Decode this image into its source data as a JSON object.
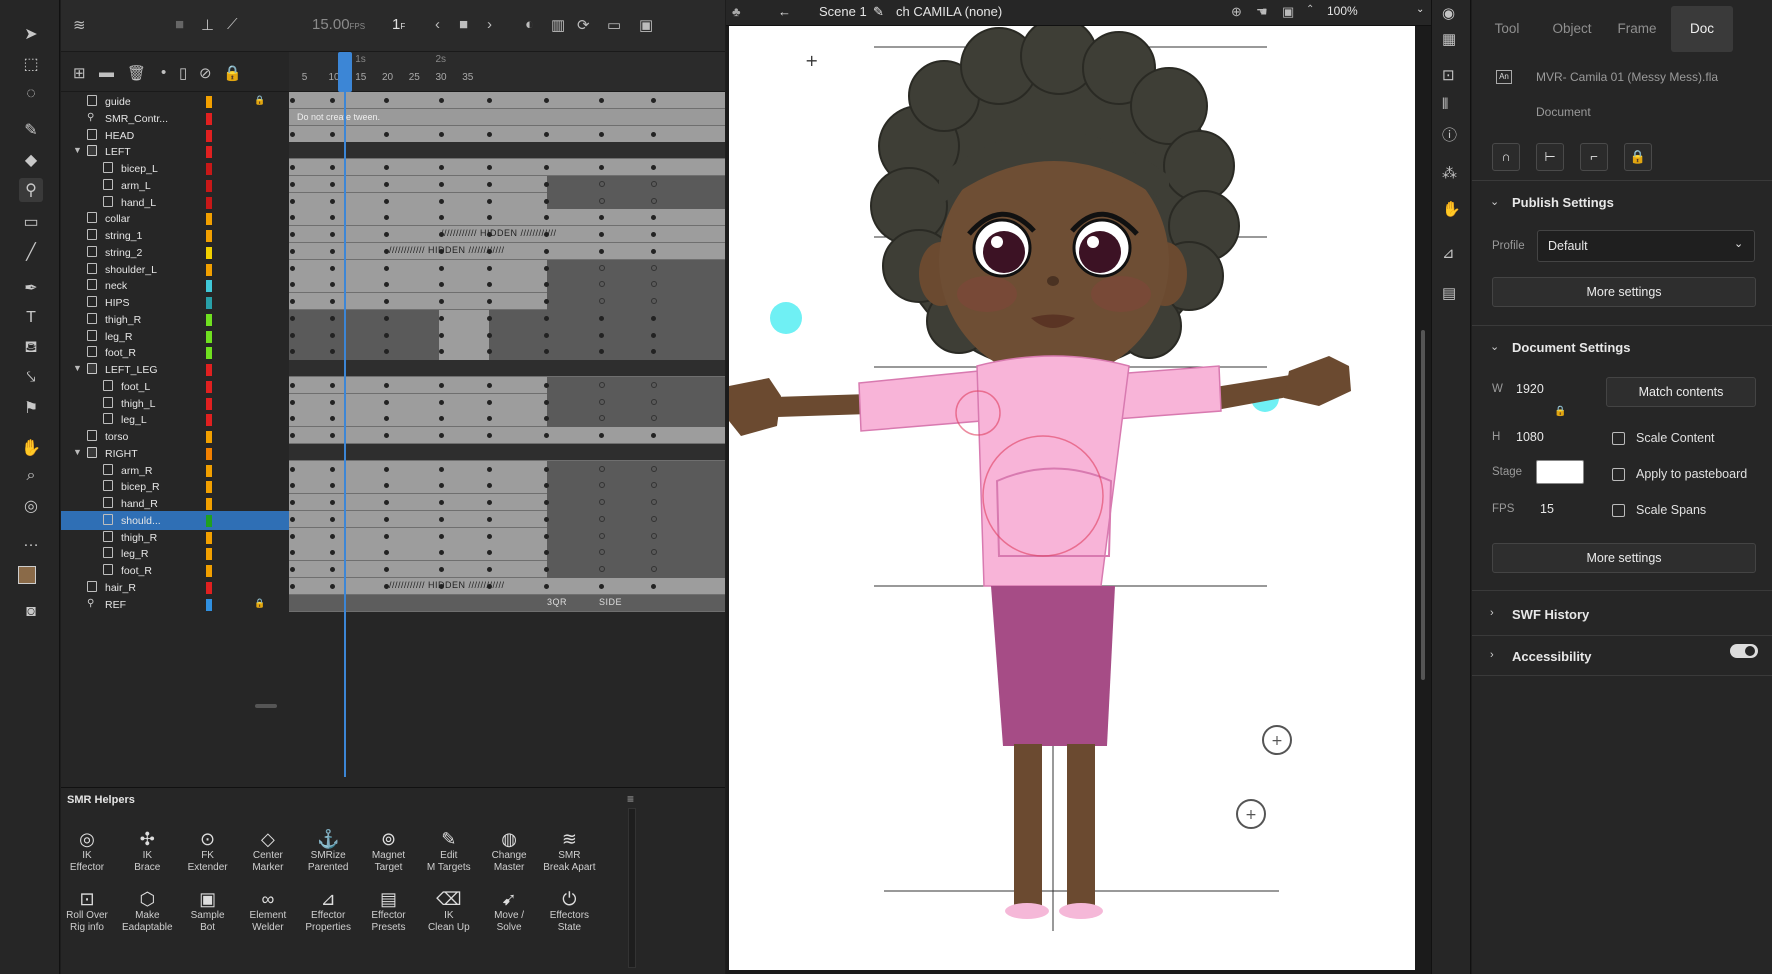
{
  "toolbar": {
    "tools": [
      "selection-icon",
      "free-transform-icon",
      "lasso-icon",
      "brush-icon",
      "eraser-icon",
      "bone-icon",
      "rectangle-icon",
      "line-icon",
      "pen-icon",
      "text-icon",
      "paint-bucket-icon",
      "eyedropper-icon",
      "pin-icon",
      "hand-icon",
      "zoom-icon",
      "camera-icon",
      "more-icon"
    ],
    "stroke_color": "#8a6a48",
    "fill_color": "#ffffff"
  },
  "timeline": {
    "fps": "15.00",
    "fps_unit": "FPS",
    "frame": "1",
    "frame_unit": "F",
    "ruler_numbers": [
      "5",
      "10",
      "15",
      "20",
      "25",
      "30",
      "35"
    ],
    "ruler_seconds": [
      "1s",
      "2s"
    ],
    "tween_message": "Do not create tween.",
    "hidden_label": "//////////// HIDDEN ////////////",
    "ref_labels": [
      "3QR",
      "SIDE"
    ],
    "layers": [
      {
        "name": "guide",
        "type": "layer",
        "indent": 0,
        "color": "#f2a000",
        "lock": true
      },
      {
        "name": "SMR_Contr...",
        "type": "bone",
        "indent": 0,
        "color": "#e02020",
        "lock": false
      },
      {
        "name": "HEAD",
        "type": "layer",
        "indent": 0,
        "color": "#e02020",
        "lock": false
      },
      {
        "name": "LEFT",
        "type": "folder",
        "indent": 0,
        "color": "#e02020",
        "lock": false
      },
      {
        "name": "bicep_L",
        "type": "layer",
        "indent": 1,
        "color": "#c81818",
        "lock": false
      },
      {
        "name": "arm_L",
        "type": "layer",
        "indent": 1,
        "color": "#c81818",
        "lock": false
      },
      {
        "name": "hand_L",
        "type": "layer",
        "indent": 1,
        "color": "#c81818",
        "lock": false
      },
      {
        "name": "collar",
        "type": "layer",
        "indent": 0,
        "color": "#f2a000",
        "lock": false
      },
      {
        "name": "string_1",
        "type": "layer",
        "indent": 0,
        "color": "#f2a000",
        "lock": false
      },
      {
        "name": "string_2",
        "type": "layer",
        "indent": 0,
        "color": "#f2d000",
        "lock": false
      },
      {
        "name": "shoulder_L",
        "type": "layer",
        "indent": 0,
        "color": "#f2a000",
        "lock": false
      },
      {
        "name": "neck",
        "type": "layer",
        "indent": 0,
        "color": "#40c8d8",
        "lock": false
      },
      {
        "name": "HIPS",
        "type": "layer",
        "indent": 0,
        "color": "#28a0a8",
        "lock": false
      },
      {
        "name": "thigh_R",
        "type": "layer",
        "indent": 0,
        "color": "#70e020",
        "lock": false
      },
      {
        "name": "leg_R",
        "type": "layer",
        "indent": 0,
        "color": "#70e020",
        "lock": false
      },
      {
        "name": "foot_R",
        "type": "layer",
        "indent": 0,
        "color": "#70e020",
        "lock": false
      },
      {
        "name": "LEFT_LEG",
        "type": "folder",
        "indent": 0,
        "color": "#e02020",
        "lock": false
      },
      {
        "name": "foot_L",
        "type": "layer",
        "indent": 1,
        "color": "#e02020",
        "lock": false
      },
      {
        "name": "thigh_L",
        "type": "layer",
        "indent": 1,
        "color": "#e02020",
        "lock": false
      },
      {
        "name": "leg_L",
        "type": "layer",
        "indent": 1,
        "color": "#e02020",
        "lock": false
      },
      {
        "name": "torso",
        "type": "layer",
        "indent": 0,
        "color": "#f2a000",
        "lock": false
      },
      {
        "name": "RIGHT",
        "type": "folder",
        "indent": 0,
        "color": "#f28000",
        "lock": false
      },
      {
        "name": "arm_R",
        "type": "layer",
        "indent": 1,
        "color": "#f2a000",
        "lock": false
      },
      {
        "name": "bicep_R",
        "type": "layer",
        "indent": 1,
        "color": "#f2a000",
        "lock": false
      },
      {
        "name": "hand_R",
        "type": "layer",
        "indent": 1,
        "color": "#f2a000",
        "lock": false
      },
      {
        "name": "should...",
        "type": "layer",
        "indent": 1,
        "color": "#20a020",
        "lock": false,
        "selected": true
      },
      {
        "name": "thigh_R",
        "type": "layer",
        "indent": 1,
        "color": "#f2a000",
        "lock": false
      },
      {
        "name": "leg_R",
        "type": "layer",
        "indent": 1,
        "color": "#f2a000",
        "lock": false
      },
      {
        "name": "foot_R",
        "type": "layer",
        "indent": 1,
        "color": "#f2a000",
        "lock": false
      },
      {
        "name": "hair_R",
        "type": "layer",
        "indent": 0,
        "color": "#e02020",
        "lock": false
      },
      {
        "name": "REF",
        "type": "bone",
        "indent": 0,
        "color": "#3090e0",
        "lock": true
      }
    ]
  },
  "smr_helpers": {
    "title": "SMR Helpers",
    "items": [
      {
        "label1": "IK",
        "label2": "Effector",
        "icon": "target-icon"
      },
      {
        "label1": "IK",
        "label2": "Brace",
        "icon": "brace-icon"
      },
      {
        "label1": "FK",
        "label2": "Extender",
        "icon": "extender-icon"
      },
      {
        "label1": "Center",
        "label2": "Marker",
        "icon": "marker-icon"
      },
      {
        "label1": "SMRize",
        "label2": "Parented",
        "icon": "smrize-icon"
      },
      {
        "label1": "Magnet",
        "label2": "Target",
        "icon": "magnet-icon"
      },
      {
        "label1": "Edit",
        "label2": "M Targets",
        "icon": "edit-icon"
      },
      {
        "label1": "Change",
        "label2": "Master",
        "icon": "change-icon"
      },
      {
        "label1": "SMR",
        "label2": "Break Apart",
        "icon": "stack-icon"
      },
      {
        "label1": "Roll Over",
        "label2": "Rig info",
        "icon": "rollover-icon"
      },
      {
        "label1": "Make",
        "label2": "Eadaptable",
        "icon": "make-icon"
      },
      {
        "label1": "Sample",
        "label2": "Bot",
        "icon": "bot-icon"
      },
      {
        "label1": "Element",
        "label2": "Welder",
        "icon": "welder-icon"
      },
      {
        "label1": "Effector",
        "label2": "Properties",
        "icon": "properties-icon"
      },
      {
        "label1": "Effector",
        "label2": "Presets",
        "icon": "presets-icon"
      },
      {
        "label1": "IK",
        "label2": "Clean Up",
        "icon": "cleanup-icon"
      },
      {
        "label1": "Move /",
        "label2": "Solve",
        "icon": "move-icon"
      },
      {
        "label1": "Effectors",
        "label2": "State",
        "icon": "power-icon"
      }
    ]
  },
  "stage_header": {
    "scene": "Scene 1",
    "symbol": "ch CAMILA (none)",
    "zoom": "100%"
  },
  "properties": {
    "tabs": [
      "Tool",
      "Object",
      "Frame",
      "Doc"
    ],
    "active_tab": "Doc",
    "file_name": "MVR- Camila 01 (Messy Mess).fla",
    "file_type": "Document",
    "publish_settings_title": "Publish Settings",
    "profile_label": "Profile",
    "profile_value": "Default",
    "more_settings": "More settings",
    "document_settings_title": "Document Settings",
    "w_label": "W",
    "w_value": "1920",
    "h_label": "H",
    "h_value": "1080",
    "match_contents": "Match contents",
    "scale_content": "Scale Content",
    "stage_label": "Stage",
    "stage_color": "#ffffff",
    "apply_pasteboard": "Apply to pasteboard",
    "fps_label": "FPS",
    "fps_value": "15",
    "scale_spans": "Scale Spans",
    "more_settings_2": "More settings",
    "swf_history": "SWF History",
    "accessibility": "Accessibility"
  }
}
